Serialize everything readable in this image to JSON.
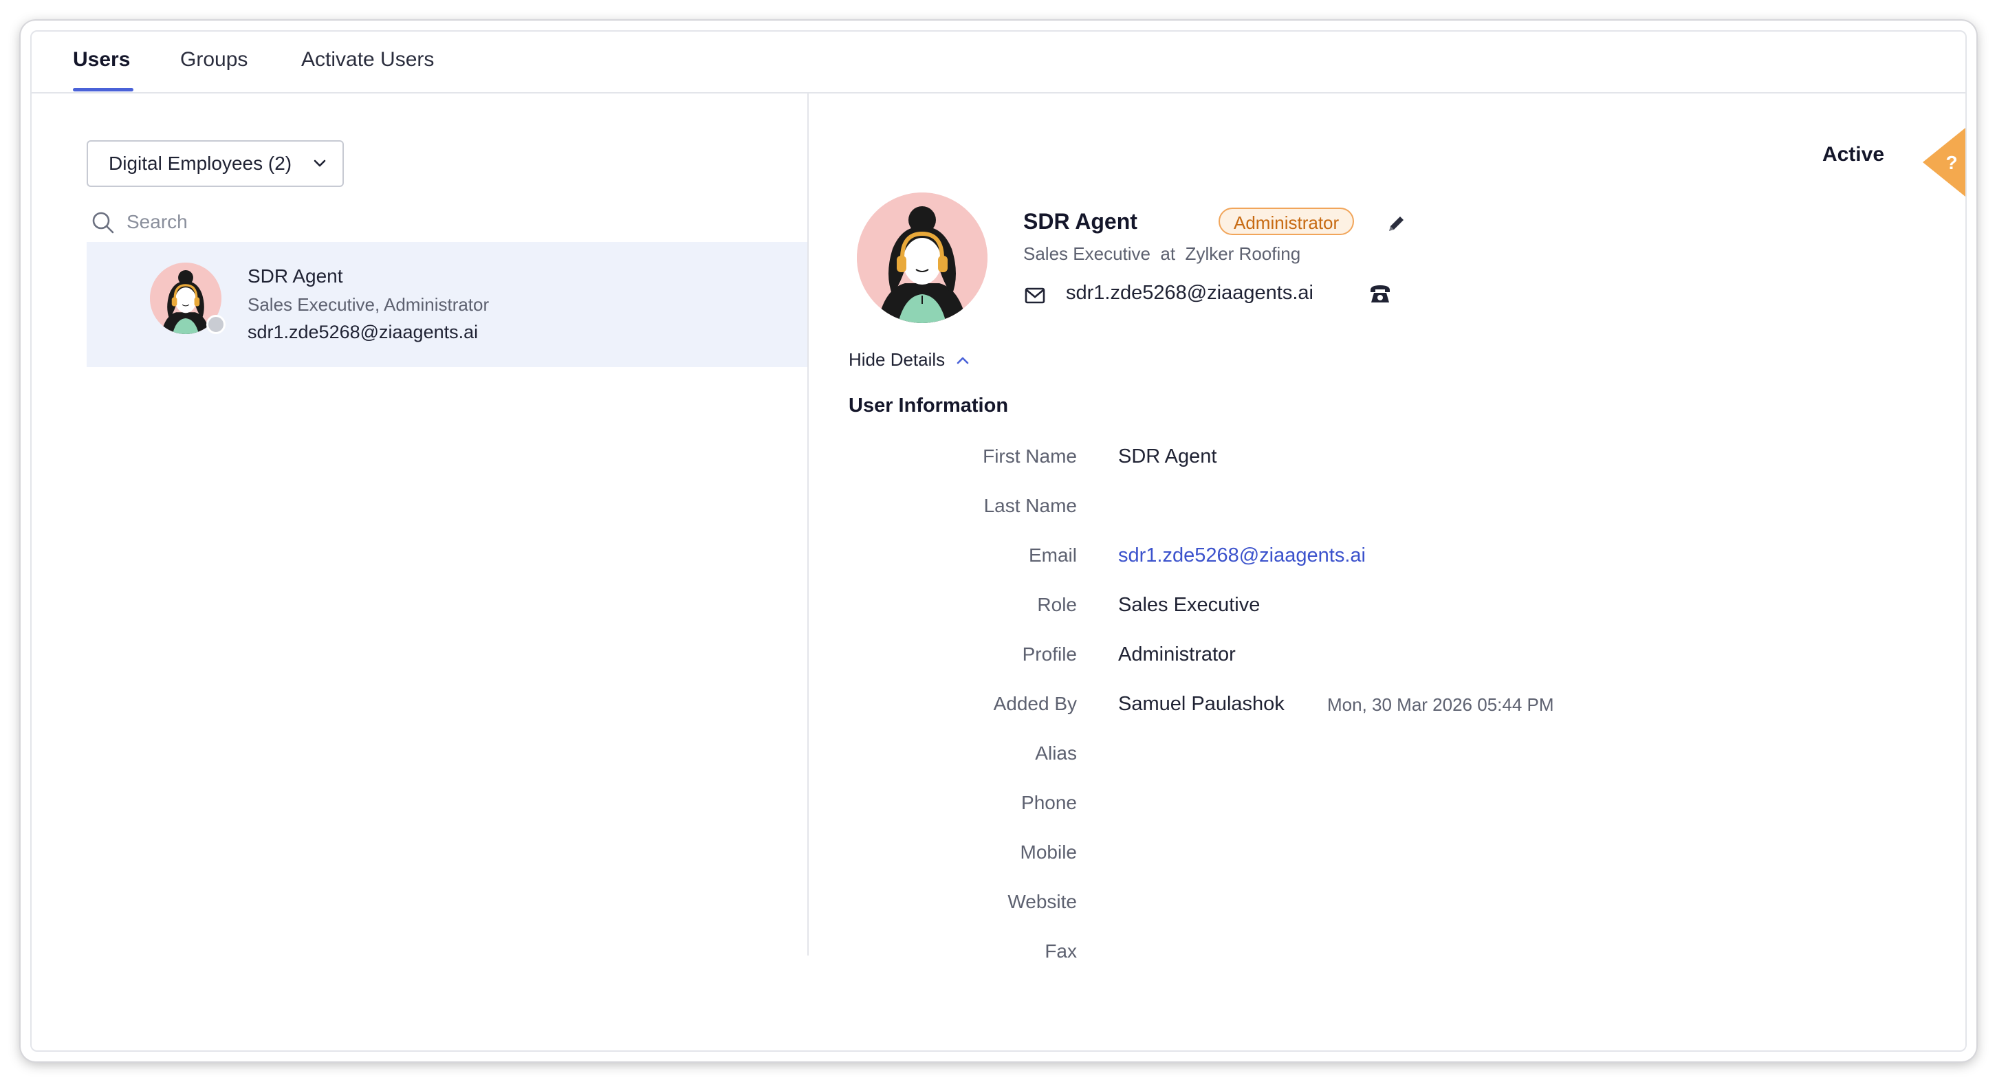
{
  "tabs": {
    "users": "Users",
    "groups": "Groups",
    "activate": "Activate Users"
  },
  "sidebar": {
    "filter_label": "Digital Employees (2)",
    "search_placeholder": "Search",
    "users": [
      {
        "name": "SDR Agent",
        "subtitle": "Sales Executive, Administrator",
        "email": "sdr1.zde5268@ziaagents.ai"
      }
    ]
  },
  "profile": {
    "status": "Active",
    "name": "SDR Agent",
    "badge": "Administrator",
    "subtitle": "Sales Executive  at  Zylker Roofing",
    "email": "sdr1.zde5268@ziaagents.ai",
    "hide_details": "Hide Details",
    "help_symbol": "?"
  },
  "user_info": {
    "title": "User Information",
    "fields": [
      {
        "label": "First Name",
        "value": "SDR Agent"
      },
      {
        "label": "Last Name",
        "value": ""
      },
      {
        "label": "Email",
        "value": "sdr1.zde5268@ziaagents.ai"
      },
      {
        "label": "Role",
        "value": "Sales Executive"
      },
      {
        "label": "Profile",
        "value": "Administrator"
      },
      {
        "label": "Added By",
        "value": "Samuel Paulashok",
        "extra": "Mon, 30 Mar 2026 05:44 PM"
      },
      {
        "label": "Alias",
        "value": ""
      },
      {
        "label": "Phone",
        "value": ""
      },
      {
        "label": "Mobile",
        "value": ""
      },
      {
        "label": "Website",
        "value": ""
      },
      {
        "label": "Fax",
        "value": ""
      }
    ]
  },
  "colors": {
    "accent": "#4a62d8",
    "link": "#3b52cc",
    "badge_border": "#f1a55a",
    "badge_text": "#c76a12",
    "help_tab": "#f4a94e",
    "selected_row": "#eef2fb"
  }
}
